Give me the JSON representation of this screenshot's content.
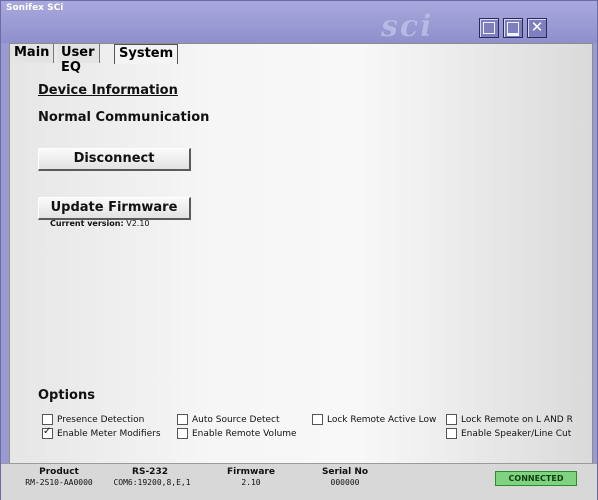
{
  "window": {
    "title": "Sonifex SCi",
    "logo_text": "sci",
    "controls": {
      "restore_icon": "restore-icon",
      "minimize_icon": "minimize-icon",
      "close_icon": "close-icon",
      "close_glyph": "✕"
    }
  },
  "tabs": [
    {
      "label": "Main",
      "active": false
    },
    {
      "label": "User EQ",
      "active": false
    },
    {
      "label": "System",
      "active": true
    }
  ],
  "system": {
    "device_info_title": "Device Information",
    "communication_status": "Normal Communication",
    "disconnect_label": "Disconnect",
    "update_firmware_label": "Update Firmware",
    "current_version_label": "Current version:",
    "current_version_value": "V2.10"
  },
  "options": {
    "title": "Options",
    "items": [
      {
        "label": "Presence Detection",
        "checked": false
      },
      {
        "label": "Enable Meter Modifiers",
        "checked": true
      },
      {
        "label": "Auto Source Detect",
        "checked": false
      },
      {
        "label": "Enable Remote Volume",
        "checked": false
      },
      {
        "label": "Lock Remote Active Low",
        "checked": false
      },
      {
        "label": "Lock Remote on L AND R",
        "checked": false
      },
      {
        "label": "Enable Speaker/Line Cut",
        "checked": false
      }
    ]
  },
  "status": {
    "product_label": "Product",
    "product_value": "RM-2S10-AA0000",
    "rs232_label": "RS-232",
    "rs232_value": "COM6:19200,8,E,1",
    "firmware_label": "Firmware",
    "firmware_value": "2.10",
    "serial_label": "Serial No",
    "serial_value": "000000",
    "connection": "CONNECTED",
    "connection_color": "#7fd27f"
  },
  "colors": {
    "frame": "#9a9ad0",
    "titlebar": "#a9a9de"
  }
}
